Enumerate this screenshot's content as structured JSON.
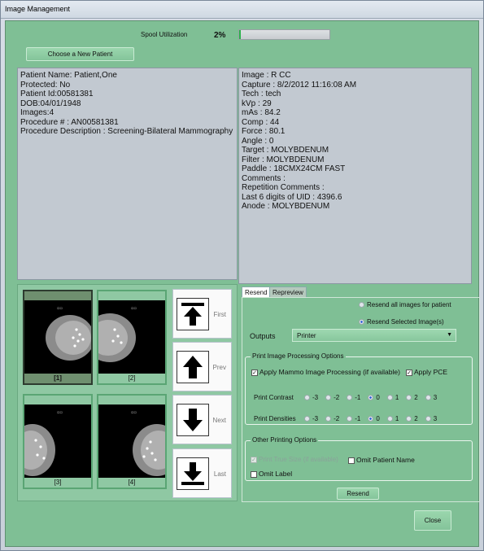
{
  "window": {
    "title": "Image Management"
  },
  "spool": {
    "label": "Spool Utilization",
    "percent_text": "2%",
    "progress": 0.02
  },
  "choose_patient_label": "Choose a New  Patient",
  "patient_info": [
    "Patient Name: Patient,One",
    "Protected: No",
    "Patient Id:00581381",
    "DOB:04/01/1948",
    "Images:4",
    "Procedure # : AN00581381",
    "Procedure Description : Screening-Bilateral Mammography"
  ],
  "image_info": [
    "Image : R CC",
    "Capture : 8/2/2012 11:16:08 AM",
    "Tech : tech",
    "kVp : 29",
    "mAs : 84.2",
    "Comp : 44",
    "Force :  80.1",
    "Angle : 0",
    "Target : MOLYBDENUM",
    "Filter : MOLYBDENUM",
    "Paddle : 18CMX24CM FAST",
    "Comments :",
    "Repetition Comments :",
    "Last 6 digits of UID : 4396.6",
    "Anode : MOLYBDENUM"
  ],
  "thumbnails": [
    {
      "caption": "[1]",
      "selected": true
    },
    {
      "caption": "[2]",
      "selected": false
    },
    {
      "caption": "[3]",
      "selected": false
    },
    {
      "caption": "[4]",
      "selected": false
    }
  ],
  "nav": {
    "first": "First",
    "prev": "Prev",
    "next": "Next",
    "last": "Last"
  },
  "tabs": {
    "resend": "Resend",
    "repreview": "Repreview",
    "active": "Resend"
  },
  "resend": {
    "all_label": "Resend all images for patient",
    "selected_label": "Resend Selected Image(s)",
    "selected_choice": "selected",
    "outputs_label": "Outputs",
    "outputs_value": "Printer",
    "processing_group_title": "Print Image Processing Options",
    "apply_mammo_label": "Apply Mammo Image Processing (if available)",
    "apply_mammo_checked": true,
    "apply_pce_label": "Apply PCE",
    "apply_pce_checked": true,
    "contrast_label": "Print Contrast",
    "densities_label": "Print Densities",
    "scale_options": [
      "-3",
      "-2",
      "-1",
      "0",
      "1",
      "2",
      "3"
    ],
    "contrast_value": "0",
    "densities_value": "0",
    "other_group_title": "Other Printing Options",
    "true_size_label": "Print True Size (if available)",
    "true_size_checked": true,
    "omit_patient_label": "Omit Patient Name",
    "omit_label_label": "Omit Label",
    "resend_button": "Resend"
  },
  "close_label": "Close"
}
